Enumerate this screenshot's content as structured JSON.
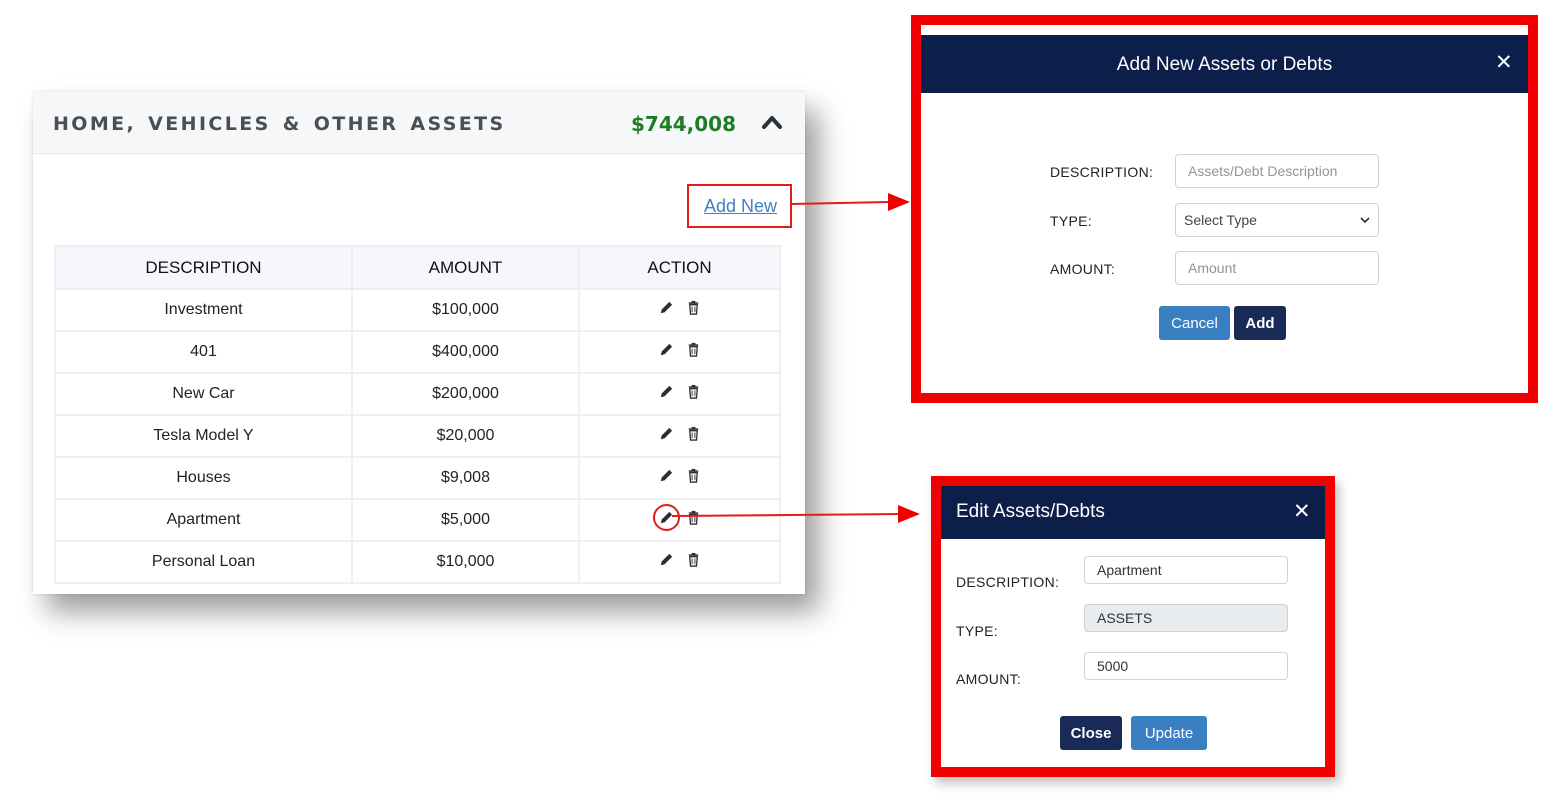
{
  "panel": {
    "title": "HOME, VEHICLES & OTHER ASSETS",
    "total": "$744,008",
    "add_new_label": "Add New",
    "columns": [
      "DESCRIPTION",
      "AMOUNT",
      "ACTION"
    ],
    "rows": [
      {
        "description": "Investment",
        "amount": "$100,000"
      },
      {
        "description": "401",
        "amount": "$400,000"
      },
      {
        "description": "New Car",
        "amount": "$200,000"
      },
      {
        "description": "Tesla Model Y",
        "amount": "$20,000"
      },
      {
        "description": "Houses",
        "amount": "$9,008"
      },
      {
        "description": "Apartment",
        "amount": "$5,000"
      },
      {
        "description": "Personal Loan",
        "amount": "$10,000"
      }
    ]
  },
  "add_modal": {
    "title": "Add New Assets or Debts",
    "close_glyph": "✕",
    "description_label": "DESCRIPTION:",
    "description_placeholder": "Assets/Debt Description",
    "type_label": "TYPE:",
    "type_selected": "Select Type",
    "amount_label": "AMOUNT:",
    "amount_placeholder": "Amount",
    "cancel_label": "Cancel",
    "add_label": "Add"
  },
  "edit_modal": {
    "title": "Edit Assets/Debts",
    "close_glyph": "✕",
    "description_label": "DESCRIPTION:",
    "description_value": "Apartment",
    "type_label": "TYPE:",
    "type_value": "ASSETS",
    "amount_label": "AMOUNT:",
    "amount_value": "5000",
    "close_label": "Close",
    "update_label": "Update"
  },
  "colors": {
    "header_navy": "#0b1f4a",
    "highlight_red": "#f00000",
    "total_green": "#1e7d24",
    "link_blue": "#3f7fc6"
  },
  "icons": [
    "chevron-up-icon",
    "pencil-icon",
    "trash-icon",
    "close-icon",
    "chevron-down-icon"
  ]
}
